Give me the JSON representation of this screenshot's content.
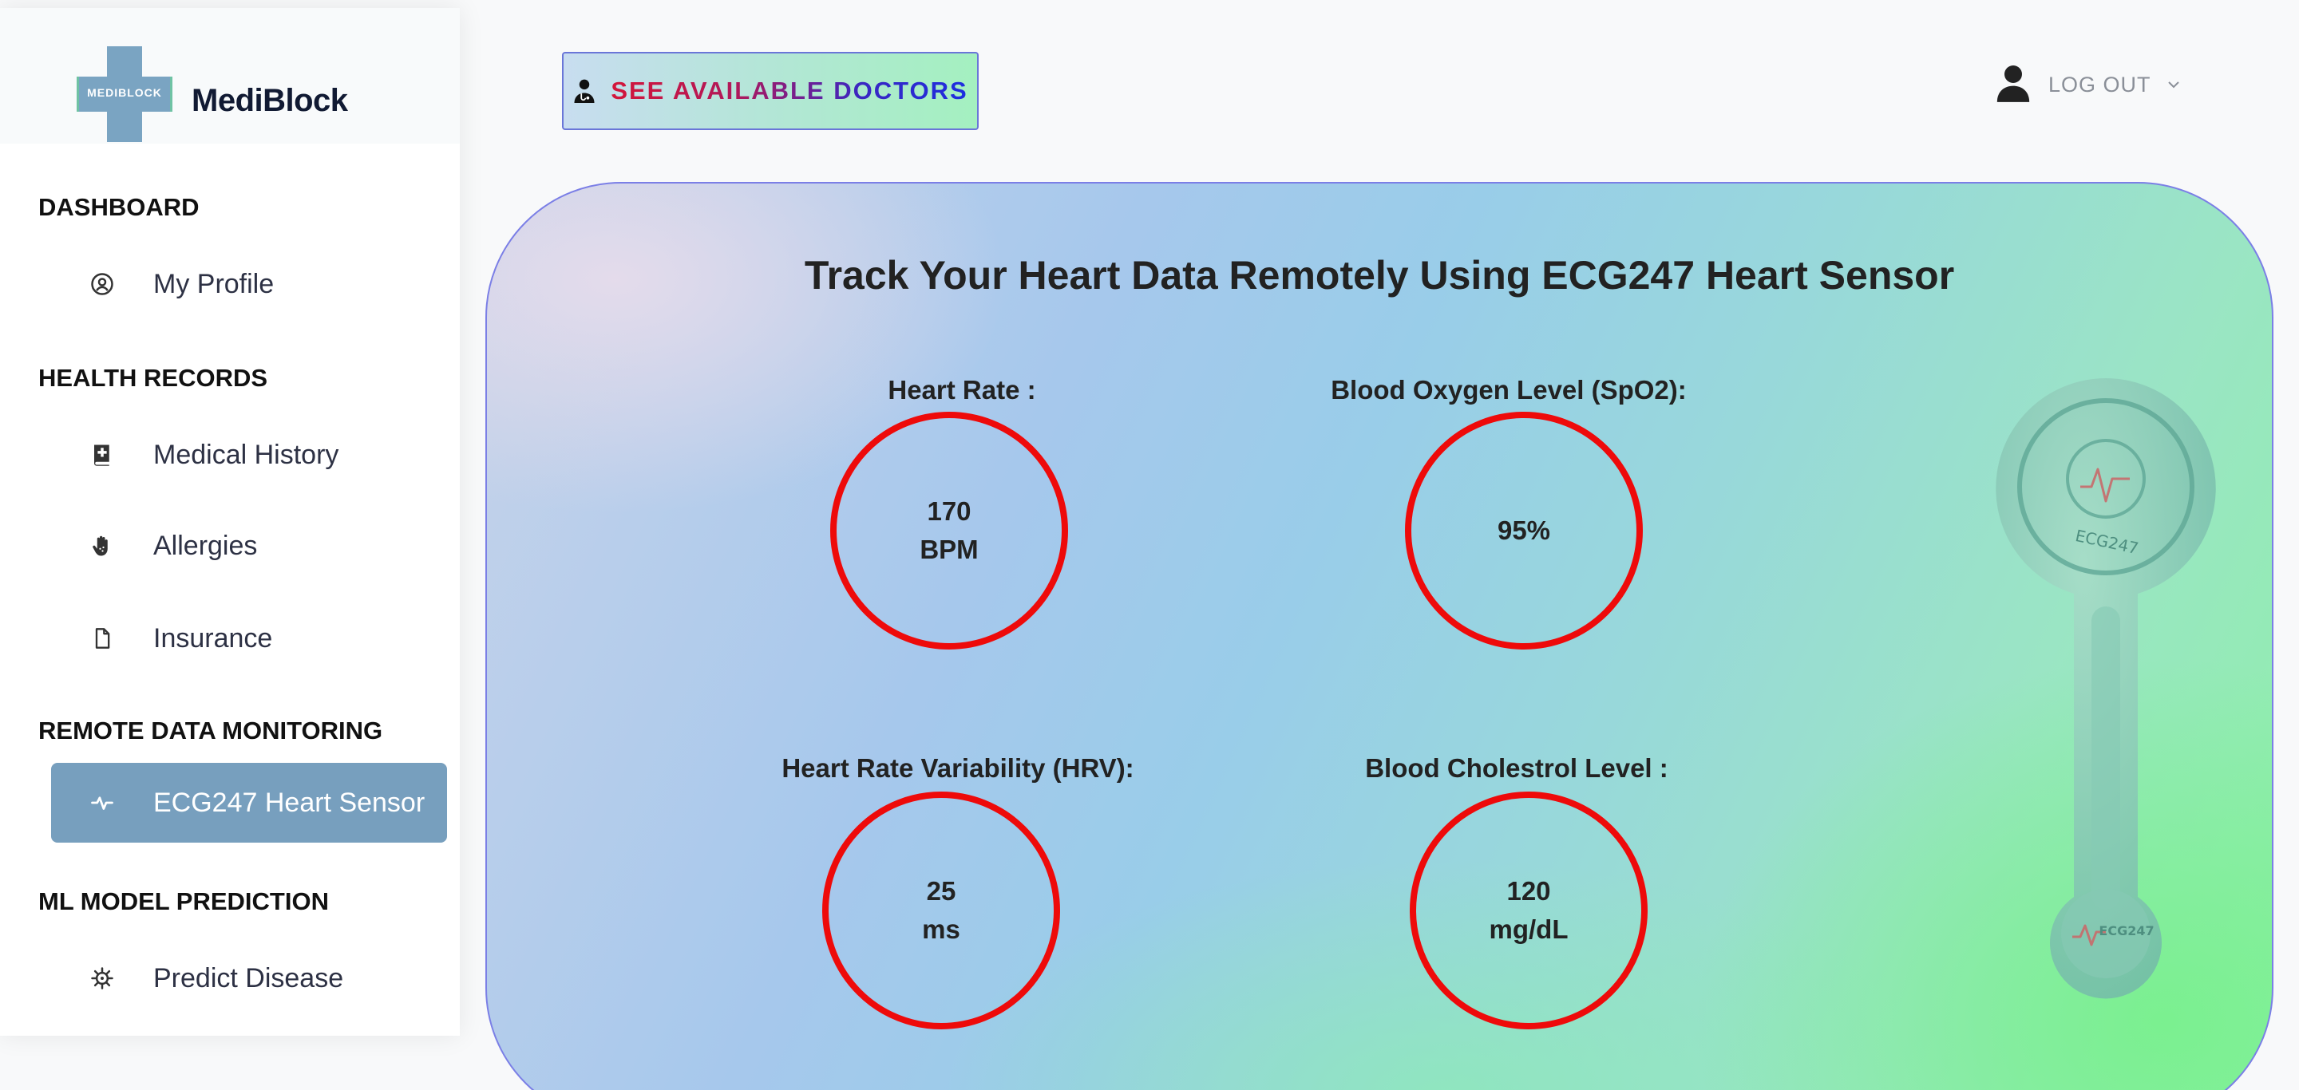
{
  "brand": {
    "logo_text": "MEDIBLOCK",
    "name": "MediBlock"
  },
  "sidebar": {
    "sections": [
      {
        "title": "DASHBOARD",
        "items": [
          {
            "label": "My Profile",
            "icon": "user-circle-icon"
          }
        ]
      },
      {
        "title": "HEALTH RECORDS",
        "items": [
          {
            "label": "Medical History",
            "icon": "medical-book-icon"
          },
          {
            "label": "Allergies",
            "icon": "hand-icon"
          },
          {
            "label": "Insurance",
            "icon": "document-icon"
          }
        ]
      },
      {
        "title": "REMOTE DATA MONITORING",
        "items": [
          {
            "label": "ECG247 Heart Sensor",
            "icon": "pulse-icon",
            "active": true
          }
        ]
      },
      {
        "title": "ML MODEL PREDICTION",
        "items": [
          {
            "label": "Predict Disease",
            "icon": "virus-icon"
          }
        ]
      }
    ]
  },
  "header": {
    "doctors_button": "SEE AVAILABLE DOCTORS",
    "user_menu": "LOG OUT"
  },
  "main": {
    "title": "Track Your Heart Data Remotely Using ECG247 Heart Sensor",
    "metrics": [
      {
        "label": "Heart Rate :",
        "value": "170",
        "unit": "BPM"
      },
      {
        "label": "Blood Oxygen Level (SpO2):",
        "value": "95%",
        "unit": ""
      },
      {
        "label": "Heart Rate Variability (HRV):",
        "value": "25",
        "unit": "ms"
      },
      {
        "label": "Blood Cholestrol Level :",
        "value": "120",
        "unit": "mg/dL"
      }
    ],
    "sensor_brand": "ECG247"
  },
  "colors": {
    "accent": "#779fbe",
    "circle": "#ee0a0a",
    "card_border": "#7b7fe6"
  }
}
